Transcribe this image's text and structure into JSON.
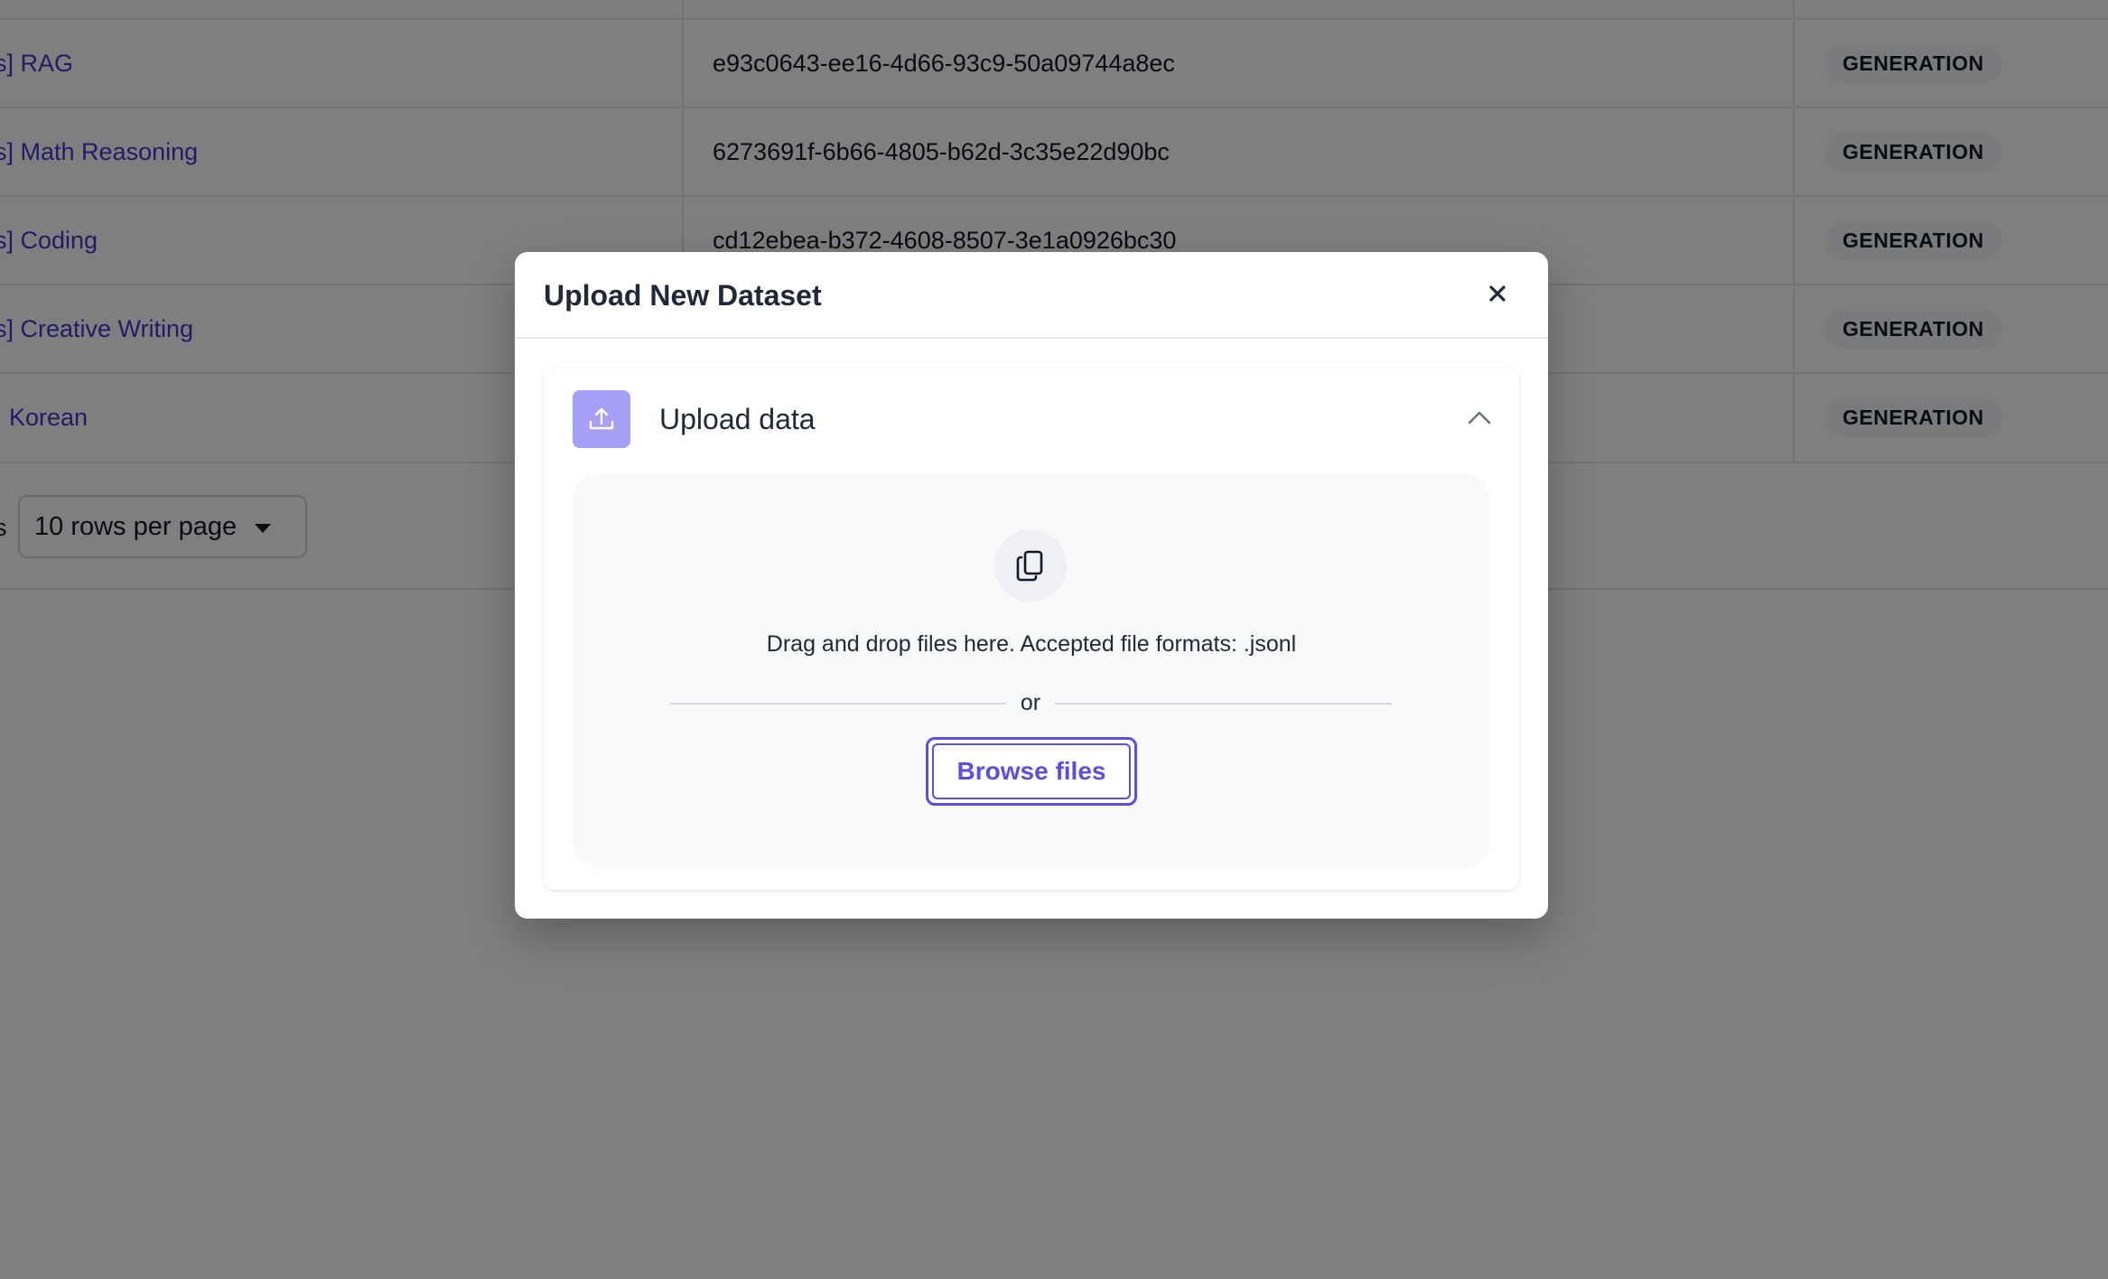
{
  "table": {
    "rows": [
      {
        "name_prefix": "s] ",
        "name": "RAG",
        "id": "e93c0643-ee16-4d66-93c9-50a09744a8ec",
        "type": "GENERATION"
      },
      {
        "name_prefix": "s] ",
        "name": "Math Reasoning",
        "id": "6273691f-6b66-4805-b62d-3c35e22d90bc",
        "type": "GENERATION"
      },
      {
        "name_prefix": "s] ",
        "name": "Coding",
        "id": "cd12ebea-b372-4608-8507-3e1a0926bc30",
        "type": "GENERATION"
      },
      {
        "name_prefix": "s] ",
        "name": "Creative Writing",
        "id": "",
        "type": "GENERATION"
      },
      {
        "name_prefix": "",
        "name": "Korean",
        "id": "",
        "type": "GENERATION"
      }
    ]
  },
  "pagination": {
    "rows_label": "s",
    "rows_per_page": "10 rows per page"
  },
  "modal": {
    "title": "Upload New Dataset",
    "close_icon": "close-icon",
    "section_title": "Upload data",
    "section_icon": "upload-icon",
    "collapse_icon": "chevron-up-icon",
    "dropzone_icon": "copy-icon",
    "drop_text": "Drag and drop files here. Accepted file formats: .jsonl",
    "or_text": "or",
    "browse_label": "Browse files"
  },
  "colors": {
    "accent": "#5b4fe0",
    "link": "#4338ca",
    "upload_icon_bg": "#a5a0f5",
    "overlay": "rgba(0,0,0,0.5)"
  }
}
